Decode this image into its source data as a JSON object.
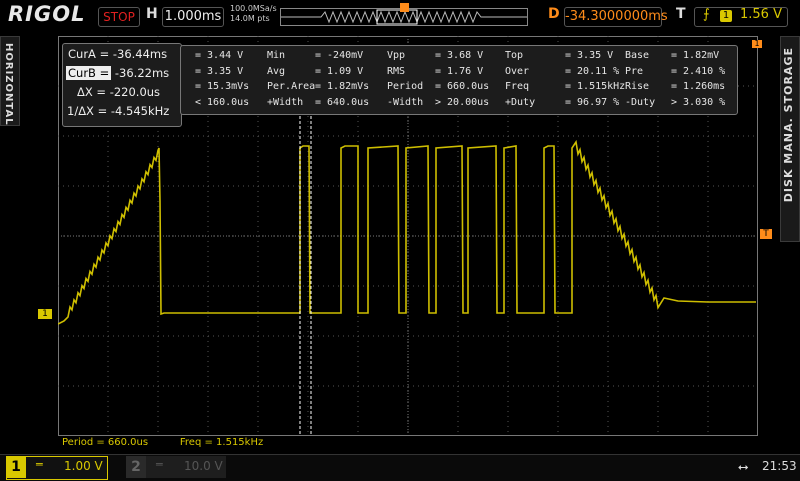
{
  "brand": "RIGOL",
  "run_state": "STOP",
  "horizontal": {
    "label": "H",
    "timebase": "1.000ms",
    "sample_rate": "100.0MSa/s",
    "memory_depth": "14.0M pts"
  },
  "delay": {
    "label": "D",
    "value": "-34.3000000ms"
  },
  "trigger": {
    "label": "T",
    "edge_icon": "rising-edge-icon",
    "channel": "1",
    "level": "1.56 V"
  },
  "side_tabs": {
    "left": "HORIZONTAL",
    "right": "DISK MANA.  STORAGE"
  },
  "cursors": {
    "cur_a": "CurA = -36.44ms",
    "cur_b_label": "CurB =",
    "cur_b_value": "-36.22ms",
    "delta_x": "ΔX = -220.0us",
    "inv_delta_x": "1/ΔX = -4.545kHz"
  },
  "measurements": [
    [
      "= 3.44 V",
      "Min",
      "= -240mV",
      "Vpp",
      "= 3.68 V",
      "Top",
      "= 3.35 V",
      "Base",
      "= 1.82mV"
    ],
    [
      "= 3.35 V",
      "Avg",
      "= 1.09 V",
      "RMS",
      "= 1.76 V",
      "Over",
      "= 20.11 %",
      "Pre",
      "= 2.410 %"
    ],
    [
      "= 15.3mVs",
      "Per.Area",
      "= 1.82mVs",
      "Period",
      "= 660.0us",
      "Freq",
      "= 1.515kHz",
      "Rise",
      "= 1.260ms"
    ],
    [
      "< 160.0us",
      "+Width",
      "= 640.0us",
      "-Width",
      "> 20.00us",
      "+Duty",
      "= 96.97 %",
      "-Duty",
      "> 3.030 %"
    ]
  ],
  "status_line": {
    "period": "Period = 660.0us",
    "freq": "Freq = 1.515kHz"
  },
  "markers": {
    "ch1": "1",
    "trigger": "T",
    "cursor": "1"
  },
  "channels": [
    {
      "number": "1",
      "coupling": "═",
      "scale": "1.00 V",
      "active": true
    },
    {
      "number": "2",
      "coupling": "═",
      "scale": "10.0 V",
      "active": false
    }
  ],
  "system": {
    "usb_icon": "usb-icon",
    "usb_glyph": "⭤",
    "time": "21:53"
  },
  "colors": {
    "ch1": "#d9c800",
    "accent": "#ff8c1a",
    "stop": "#e02020",
    "grid": "#555555"
  }
}
